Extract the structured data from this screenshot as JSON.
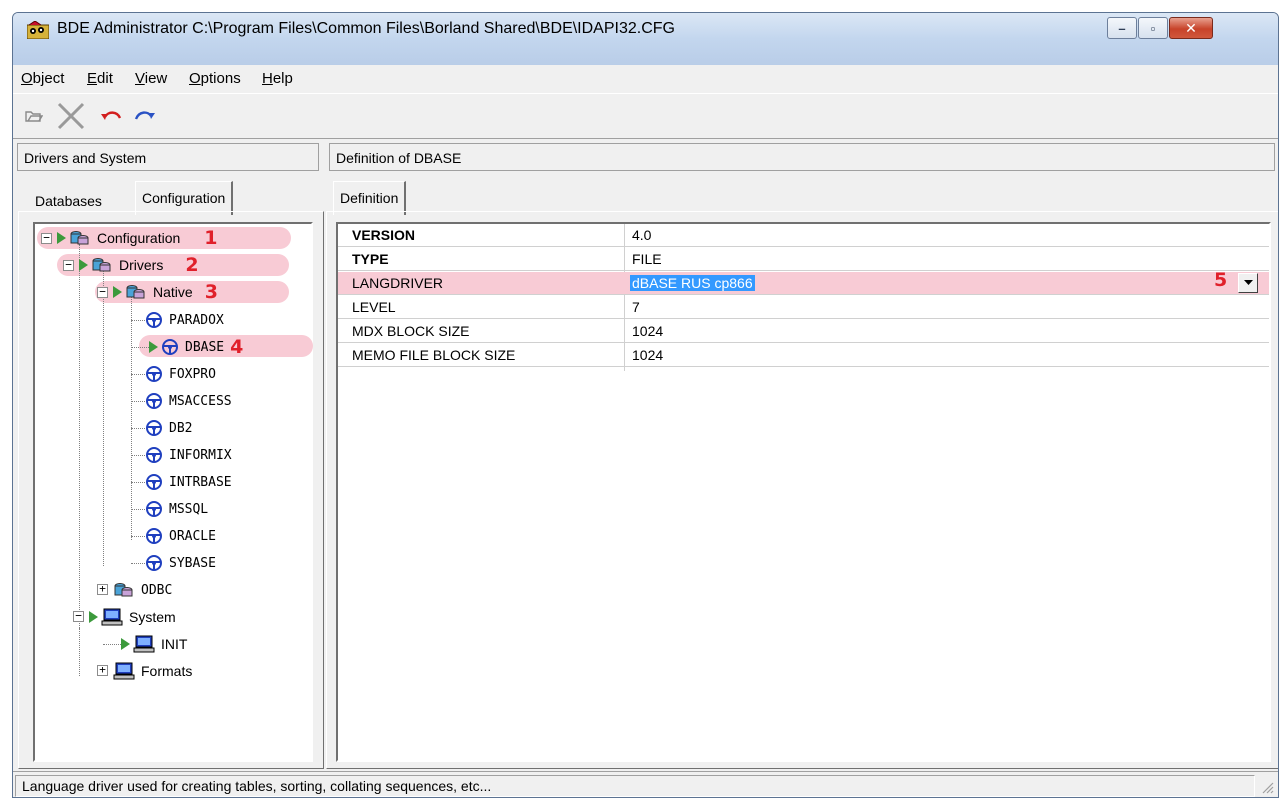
{
  "window": {
    "title": "BDE Administrator  C:\\Program Files\\Common Files\\Borland Shared\\BDE\\IDAPI32.CFG",
    "minimize_glyph": "–",
    "maximize_glyph": "▫",
    "close_glyph": "✕"
  },
  "menu": [
    "Object",
    "Edit",
    "View",
    "Options",
    "Help"
  ],
  "toolbar": [
    "open-icon",
    "delete-icon",
    "undo-icon",
    "redo-icon"
  ],
  "left_pane": {
    "header": "Drivers and System",
    "tabs": [
      "Databases",
      "Configuration"
    ],
    "active_tab": "Configuration"
  },
  "right_pane": {
    "header": "Definition of DBASE",
    "tabs": [
      "Definition"
    ]
  },
  "tree": {
    "configuration": "Configuration",
    "drivers": "Drivers",
    "native": "Native",
    "paradox": "PARADOX",
    "dbase": "DBASE",
    "foxpro": "FOXPRO",
    "msaccess": "MSACCESS",
    "db2": "DB2",
    "informix": "INFORMIX",
    "intrbase": "INTRBASE",
    "mssql": "MSSQL",
    "oracle": "ORACLE",
    "sybase": "SYBASE",
    "odbc": "ODBC",
    "system": "System",
    "init": "INIT",
    "formats": "Formats"
  },
  "annotations": {
    "a1": "1",
    "a2": "2",
    "a3": "3",
    "a4": "4",
    "a5": "5"
  },
  "definition": [
    {
      "name": "VERSION",
      "value": "4.0",
      "bold": true
    },
    {
      "name": "TYPE",
      "value": "FILE",
      "bold": true
    },
    {
      "name": "LANGDRIVER",
      "value": "dBASE RUS cp866",
      "bold": false
    },
    {
      "name": "LEVEL",
      "value": "7",
      "bold": false
    },
    {
      "name": "MDX BLOCK SIZE",
      "value": "1024",
      "bold": false
    },
    {
      "name": "MEMO FILE BLOCK SIZE",
      "value": "1024",
      "bold": false
    }
  ],
  "status": "Language driver used for creating tables, sorting, collating sequences, etc...",
  "colors": {
    "highlight": "#f8cbd5",
    "annotation": "#e0202a",
    "selection": "#3399ff",
    "play": "#3c9a3c"
  }
}
